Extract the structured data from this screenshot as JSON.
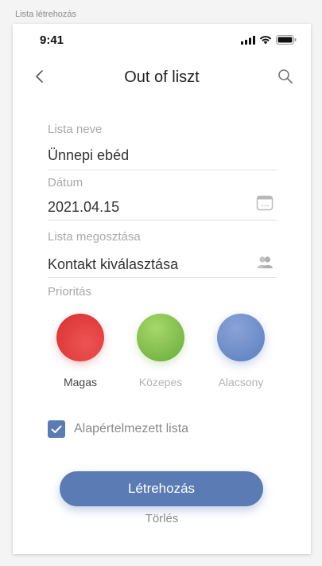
{
  "artboard_label": "Lista létrehozás",
  "status_bar": {
    "time": "9:41",
    "icons": [
      "signal-icon",
      "wifi-icon",
      "battery-icon"
    ]
  },
  "nav": {
    "title": "Out of liszt",
    "back_icon": "chevron-left-icon",
    "search_icon": "search-icon"
  },
  "form": {
    "list_name": {
      "label": "Lista neve",
      "value": "Ünnepi ebéd"
    },
    "date": {
      "label": "Dátum",
      "value": "2021.04.15",
      "icon": "calendar-icon"
    },
    "share": {
      "label": "Lista megosztása",
      "value": "Kontakt kiválasztása",
      "icon": "contacts-icon"
    }
  },
  "priority": {
    "label": "Prioritás",
    "selected": "high",
    "options": [
      {
        "key": "high",
        "label": "Magas",
        "color": "#e23b3b"
      },
      {
        "key": "medium",
        "label": "Közepes",
        "color": "#74b83e"
      },
      {
        "key": "low",
        "label": "Alacsony",
        "color": "#6a8ac8"
      }
    ]
  },
  "default_list": {
    "label": "Alapértelmezett lista",
    "checked": true
  },
  "actions": {
    "create_label": "Létrehozás",
    "delete_label": "Törlés"
  },
  "colors": {
    "accent": "#5b7bb4",
    "label_gray": "#a9a9a9",
    "text_dark": "#333333"
  }
}
